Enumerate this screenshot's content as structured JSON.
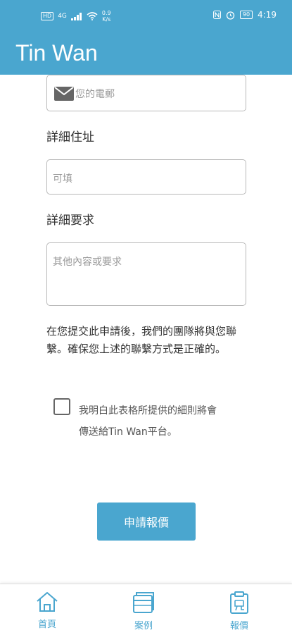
{
  "status_bar": {
    "network_badge": "HD",
    "network_type": "4G",
    "speed_value": "0.9",
    "speed_unit": "K/s",
    "battery": "90",
    "time": "4:19"
  },
  "app_bar": {
    "title": "Tin Wan"
  },
  "form": {
    "phone_placeholder": "您的電郵",
    "address_label": "詳細住址",
    "address_placeholder": "可填",
    "requirements_label": "詳細要求",
    "requirements_placeholder": "其他內容或要求",
    "notice": "在您提交此申請後，我們的團隊將與您聯繫。確保您上述的聯繫方式是正確的。",
    "agree_line1": "我明白此表格所提供的細則將會",
    "agree_line2": "傳送給Tin Wan平台。",
    "submit_label": "申請報價"
  },
  "bottom_nav": [
    {
      "label": "首頁",
      "icon": "home-icon"
    },
    {
      "label": "案例",
      "icon": "cases-icon"
    },
    {
      "label": "報價",
      "icon": "quote-icon"
    }
  ],
  "colors": {
    "primary": "#4aa6cf",
    "border": "#b9b9b9",
    "text": "#333333"
  }
}
